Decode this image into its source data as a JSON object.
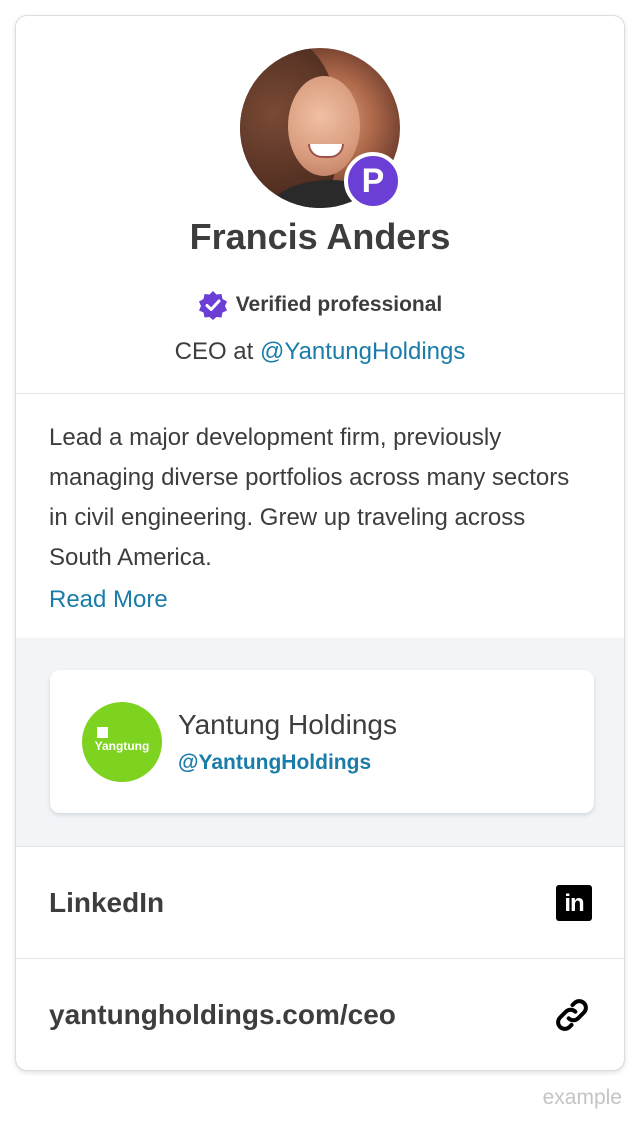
{
  "profile": {
    "name": "Francis Anders",
    "badge_letter": "P",
    "verified_label": "Verified professional",
    "role_prefix": "CEO at ",
    "role_handle": "@YantungHoldings"
  },
  "bio": {
    "text": "Lead a major development firm, previously managing diverse portfolios across many sectors in civil engineering. Grew up traveling across South America.",
    "read_more": "Read More"
  },
  "company": {
    "logo_text": "Yangtung",
    "name": "Yantung Holdings",
    "handle": "@YantungHoldings",
    "logo_color": "#7ed321"
  },
  "links": [
    {
      "label": "LinkedIn",
      "icon": "linkedin-icon",
      "icon_text": "in"
    },
    {
      "label": "yantungholdings.com/ceo",
      "icon": "link-icon"
    }
  ],
  "footer": {
    "note": "example"
  },
  "colors": {
    "accent": "#1a7ca8",
    "badge": "#6b3fd6",
    "verified": "#6b3fd6"
  }
}
